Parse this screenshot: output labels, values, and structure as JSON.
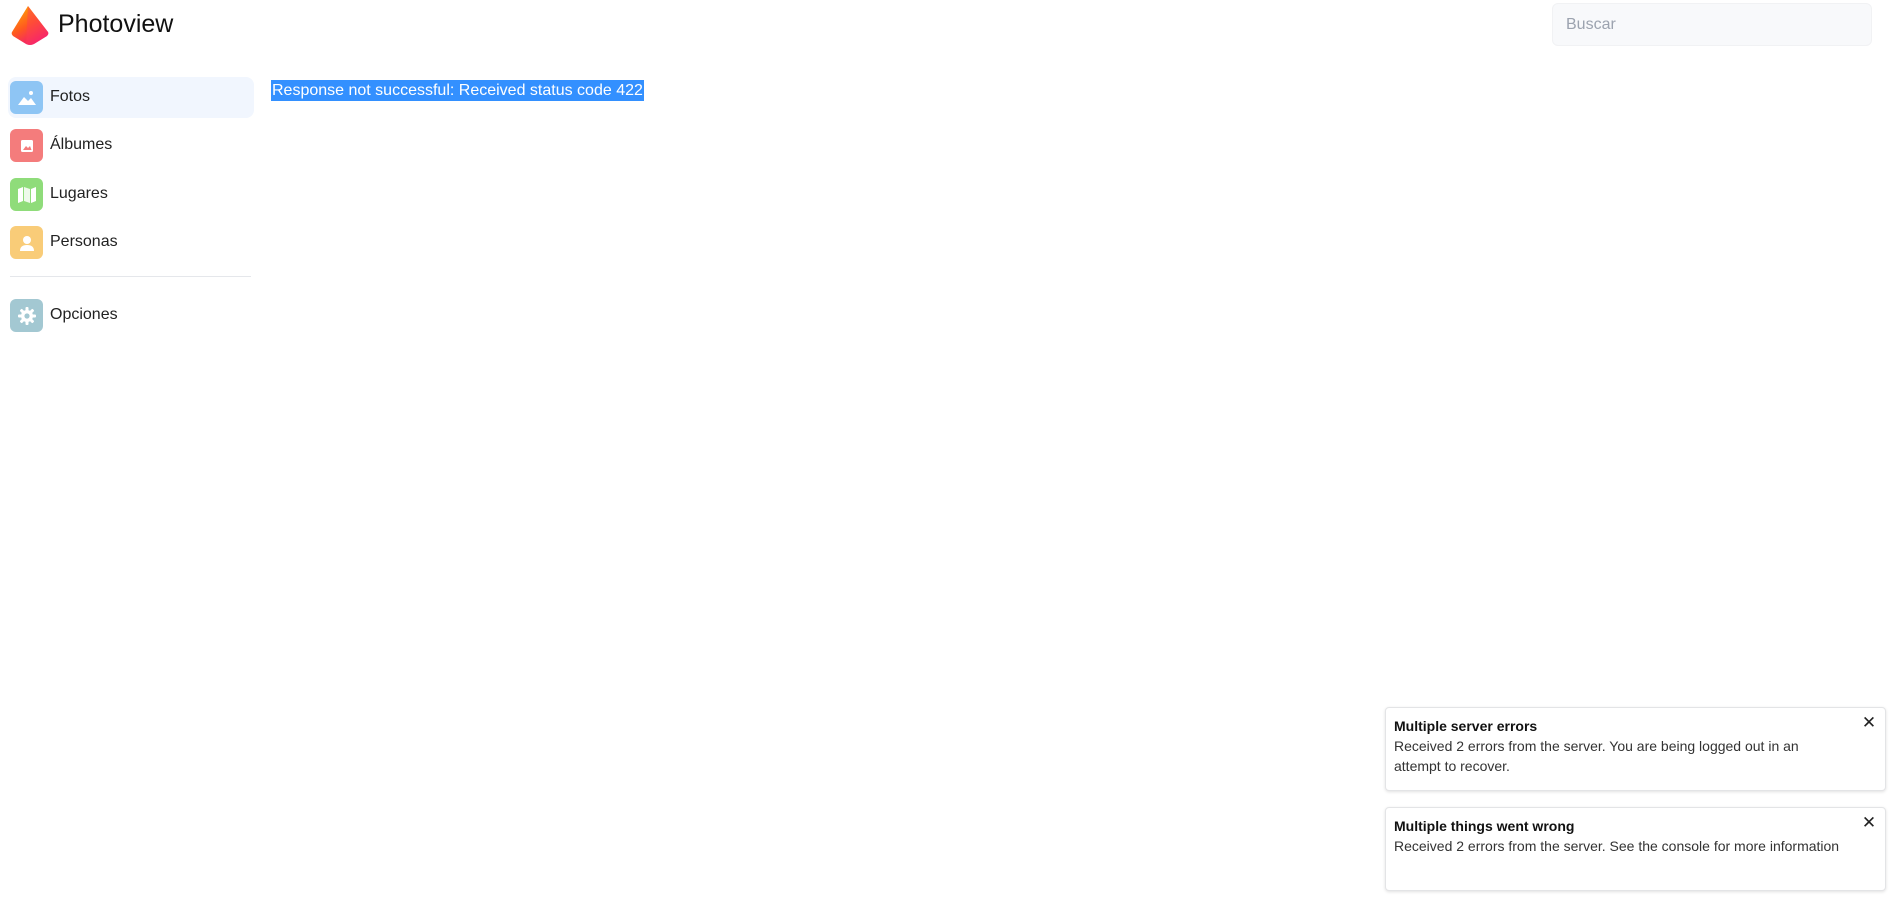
{
  "header": {
    "app_title": "Photoview",
    "search": {
      "placeholder": "Buscar",
      "value": ""
    }
  },
  "sidebar": {
    "items": [
      {
        "label": "Fotos",
        "icon": "photos-icon",
        "color": "#8ec5f4",
        "active": true
      },
      {
        "label": "Álbumes",
        "icon": "album-icon",
        "color": "#f47c7c",
        "active": false
      },
      {
        "label": "Lugares",
        "icon": "map-icon",
        "color": "#8fdc7a",
        "active": false
      },
      {
        "label": "Personas",
        "icon": "person-icon",
        "color": "#f9cc78",
        "active": false
      }
    ],
    "settings": {
      "label": "Opciones",
      "icon": "gear-icon",
      "color": "#a3c8d2"
    }
  },
  "main": {
    "error_message": "Response not successful: Received status code 422"
  },
  "notifications": [
    {
      "title": "Multiple server errors",
      "message": "Received 2 errors from the server. You are being logged out in an attempt to recover."
    },
    {
      "title": "Multiple things went wrong",
      "message": "Received 2 errors from the server. See the console for more information"
    }
  ],
  "colors": {
    "accent": "#3390ff",
    "active_nav_bg": "#f1f6fe"
  }
}
